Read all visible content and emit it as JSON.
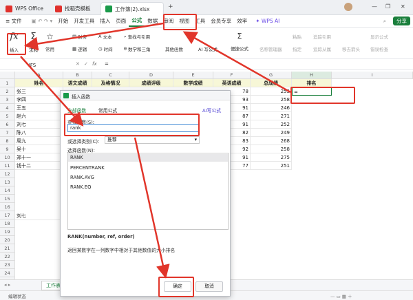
{
  "titlebar": {
    "tabs": [
      {
        "label": "WPS Office",
        "color": "#e0302c"
      },
      {
        "label": "找稻壳模板",
        "color": "#e0302c"
      },
      {
        "label": "工作簿(2).xlsx",
        "color": "#1a9a4a"
      }
    ],
    "plus": "+",
    "window_buttons": [
      "—",
      "❐",
      "✕"
    ]
  },
  "menubar": {
    "file": "≡ 文件",
    "items": [
      "开始",
      "开发工具",
      "插入",
      "页面",
      "公式",
      "数据",
      "审阅",
      "视图",
      "工具",
      "会员专享",
      "效率"
    ],
    "selected": "公式",
    "wps_ai": "WPS AI",
    "share": "分享"
  },
  "ribbon": {
    "insert_fn": "插入",
    "sum": "求和",
    "common": "常用",
    "finance": "财务",
    "logic": "逻辑",
    "text": "文本",
    "time": "时间",
    "lookup": "查找与引用",
    "math": "数学和三角",
    "other": "其他函数",
    "ai_formula": "AI 写公式",
    "convenient": "便捷公式",
    "name_mgr": "名称管理器",
    "paste": "粘贴",
    "create": "指定",
    "trace_prec": "追踪引用",
    "trace_dep": "追踪从属",
    "remove_arrow": "移去箭头",
    "show_formula": "显示公式",
    "error_check": "错误检查"
  },
  "formulabar": {
    "namebox": "IFS",
    "fx": "fx",
    "content": "="
  },
  "grid": {
    "columns": [
      "A",
      "B",
      "C",
      "D",
      "E",
      "F",
      "G",
      "H",
      "I"
    ],
    "headers": [
      "姓名",
      "语文成绩",
      "及格情况",
      "成绩评级",
      "数学成绩",
      "英语成绩",
      "总成绩",
      "排名"
    ],
    "names": [
      "张三",
      "李四",
      "王五",
      "赵六",
      "刘七",
      "陈八",
      "周九",
      "吴十",
      "郑十一",
      "钱十二"
    ],
    "english": [
      "78",
      "93",
      "91",
      "87",
      "91",
      "82",
      "83",
      "92",
      "91",
      "77"
    ],
    "totals": [
      "255",
      "258",
      "246",
      "271",
      "252",
      "249",
      "268",
      "258",
      "275",
      "251"
    ],
    "h2": "=",
    "extra_name": "刘七"
  },
  "sheetbar": {
    "sheet": "工作表1",
    "status": "编辑状态"
  },
  "dialog": {
    "title": "插入函数",
    "tab_all": "全部函数",
    "tab_common": "常用公式",
    "ai": "AI写公式",
    "search_label": "查找函数(S):",
    "search_value": "rank",
    "category_label": "或选择类别(C):",
    "category_value": "推荐",
    "select_label": "选择函数(N):",
    "functions": [
      "RANK",
      "PERCENTRANK",
      "RANK.AVG",
      "RANK.EQ"
    ],
    "signature": "RANK(number, ref, order)",
    "description": "返回某数字在一列数字中相对于其他数值的大小排名",
    "ok": "确定",
    "cancel": "取消"
  },
  "colors": {
    "accent": "#1a7f3c",
    "annotation": "#e1352a"
  }
}
